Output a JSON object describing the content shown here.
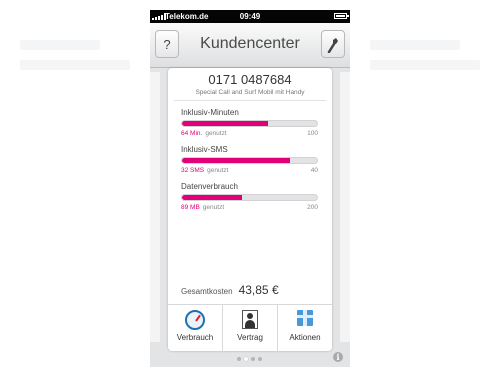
{
  "status_bar": {
    "carrier": "Telekom.de",
    "time": "09:49"
  },
  "nav": {
    "help_label": "?",
    "title": "Kundencenter",
    "settings_icon": "wrench-icon"
  },
  "account": {
    "phone_number": "0171 0487684",
    "tariff": "Special Call and Surf Mobil mit Handy"
  },
  "usage": [
    {
      "title": "Inklusiv-Minuten",
      "used": "64 Min.",
      "used_suffix": "genutzt",
      "max": "100",
      "fraction": 0.64
    },
    {
      "title": "Inklusiv-SMS",
      "used": "32 SMS",
      "used_suffix": "genutzt",
      "max": "40",
      "fraction": 0.8
    },
    {
      "title": "Datenverbrauch",
      "used": "89 MB",
      "used_suffix": "genutzt",
      "max": "200",
      "fraction": 0.445
    }
  ],
  "total": {
    "label": "Gesamtkosten",
    "value": "43,85 €"
  },
  "tabs": [
    {
      "label": "Verbrauch",
      "icon": "gauge-icon"
    },
    {
      "label": "Vertrag",
      "icon": "contact-card-icon"
    },
    {
      "label": "Aktionen",
      "icon": "gift-icon"
    }
  ],
  "pager": {
    "count": 4,
    "active": 1
  },
  "colors": {
    "accent": "#e2007a",
    "status_bar": "#050505"
  }
}
